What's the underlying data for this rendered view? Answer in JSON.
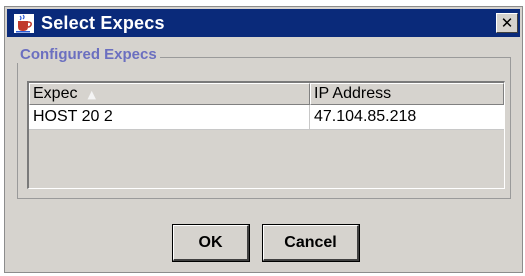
{
  "window": {
    "title": "Select Expecs",
    "icon": "java-cup-icon",
    "close_glyph": "✕"
  },
  "group": {
    "legend": "Configured Expecs"
  },
  "table": {
    "columns": [
      {
        "label": "Expec",
        "sort_icon": "▲",
        "sorted": "ascending"
      },
      {
        "label": "IP Address"
      }
    ],
    "rows": [
      {
        "expec": "HOST 20 2",
        "ip": "47.104.85.218"
      }
    ]
  },
  "buttons": {
    "ok_label": "OK",
    "cancel_label": "Cancel"
  },
  "colors": {
    "titlebar": "#0a2a7a",
    "legend_text": "#6b6fc0",
    "dialog_bg": "#d6d3ce"
  }
}
